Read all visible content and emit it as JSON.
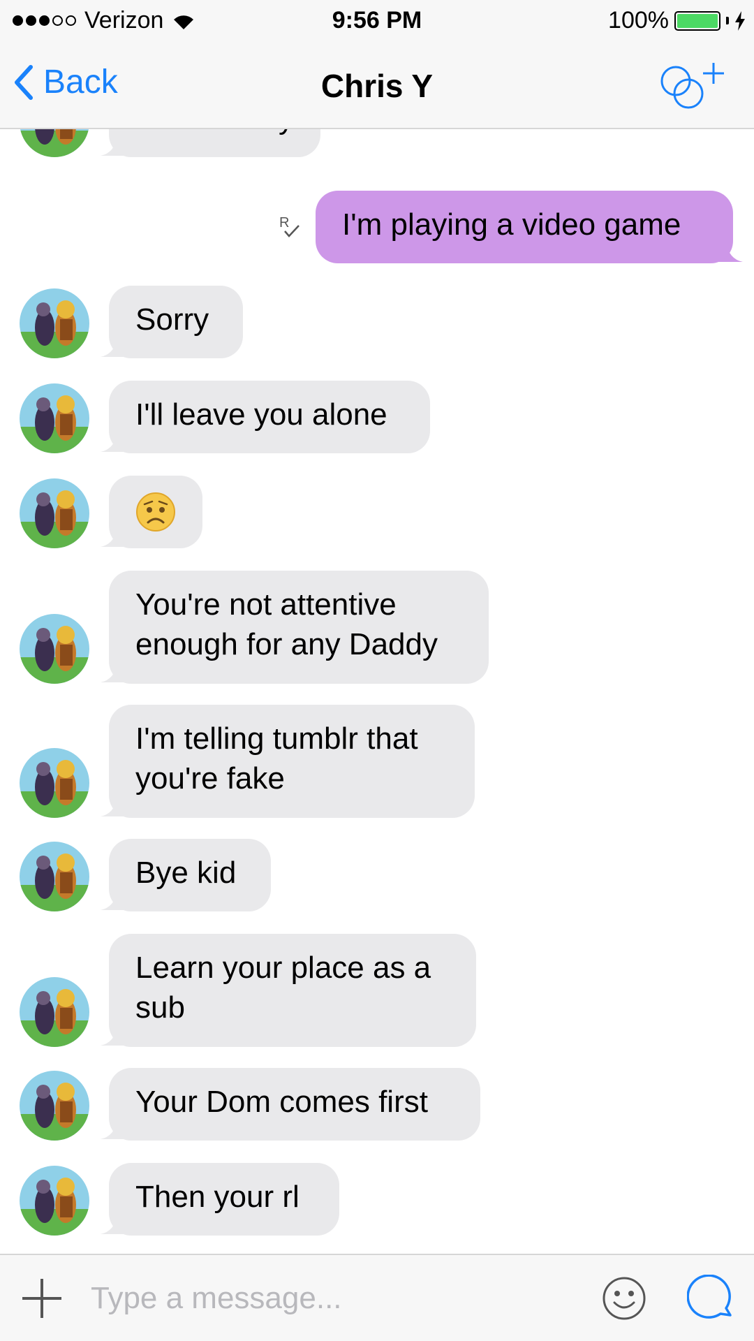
{
  "status_bar": {
    "carrier": "Verizon",
    "time": "9:56 PM",
    "battery": "100%",
    "battery_level": 1.0
  },
  "nav": {
    "back_label": "Back",
    "title": "Chris Y",
    "add_icon": "add-people-icon"
  },
  "messages": [
    {
      "side": "in",
      "text": "You're busy",
      "clipped": true
    },
    {
      "side": "out",
      "text": "I'm playing a video game",
      "status": "read"
    },
    {
      "side": "in",
      "text": "Sorry"
    },
    {
      "side": "in",
      "text": "I'll leave you alone"
    },
    {
      "side": "in",
      "emoji": "worried-face"
    },
    {
      "side": "in",
      "lines": [
        "You're not attentive",
        "enough for any Daddy"
      ]
    },
    {
      "side": "in",
      "lines": [
        "I'm telling tumblr that",
        "you're fake"
      ]
    },
    {
      "side": "in",
      "text": "Bye kid"
    },
    {
      "side": "in",
      "lines": [
        "Learn your place as a",
        "sub"
      ]
    },
    {
      "side": "in",
      "text": "Your Dom comes first"
    },
    {
      "side": "in",
      "text": "Then your rl"
    }
  ],
  "composer": {
    "placeholder": "Type a message..."
  },
  "colors": {
    "accent": "#1a82fb",
    "outgoing_bubble": "#cd97e8",
    "incoming_bubble": "#e9e9eb"
  }
}
